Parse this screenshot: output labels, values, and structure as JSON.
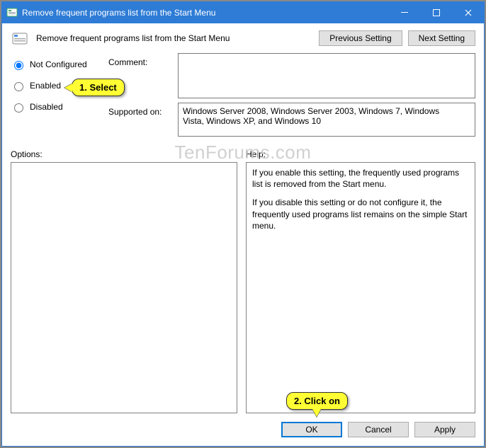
{
  "titlebar": {
    "title": "Remove frequent programs list from the Start Menu"
  },
  "header": {
    "policy_title": "Remove frequent programs list from the Start Menu",
    "prev_button": "Previous Setting",
    "next_button": "Next Setting"
  },
  "config": {
    "radios": {
      "not_configured": "Not Configured",
      "enabled": "Enabled",
      "disabled": "Disabled"
    },
    "comment_label": "Comment:",
    "comment_value": "",
    "supported_label": "Supported on:",
    "supported_value": "Windows Server 2008, Windows Server 2003, Windows 7, Windows Vista, Windows XP, and Windows 10"
  },
  "sections": {
    "options_label": "Options:",
    "help_label": "Help:"
  },
  "help_text": {
    "p1": "If you enable this setting, the frequently used programs list is removed from the Start menu.",
    "p2": "If you disable this setting or do not configure it, the frequently used programs list remains on the simple Start menu."
  },
  "buttons": {
    "ok": "OK",
    "cancel": "Cancel",
    "apply": "Apply"
  },
  "callouts": {
    "c1": "1. Select",
    "c2": "2. Click on"
  },
  "watermark": "TenForums.com"
}
